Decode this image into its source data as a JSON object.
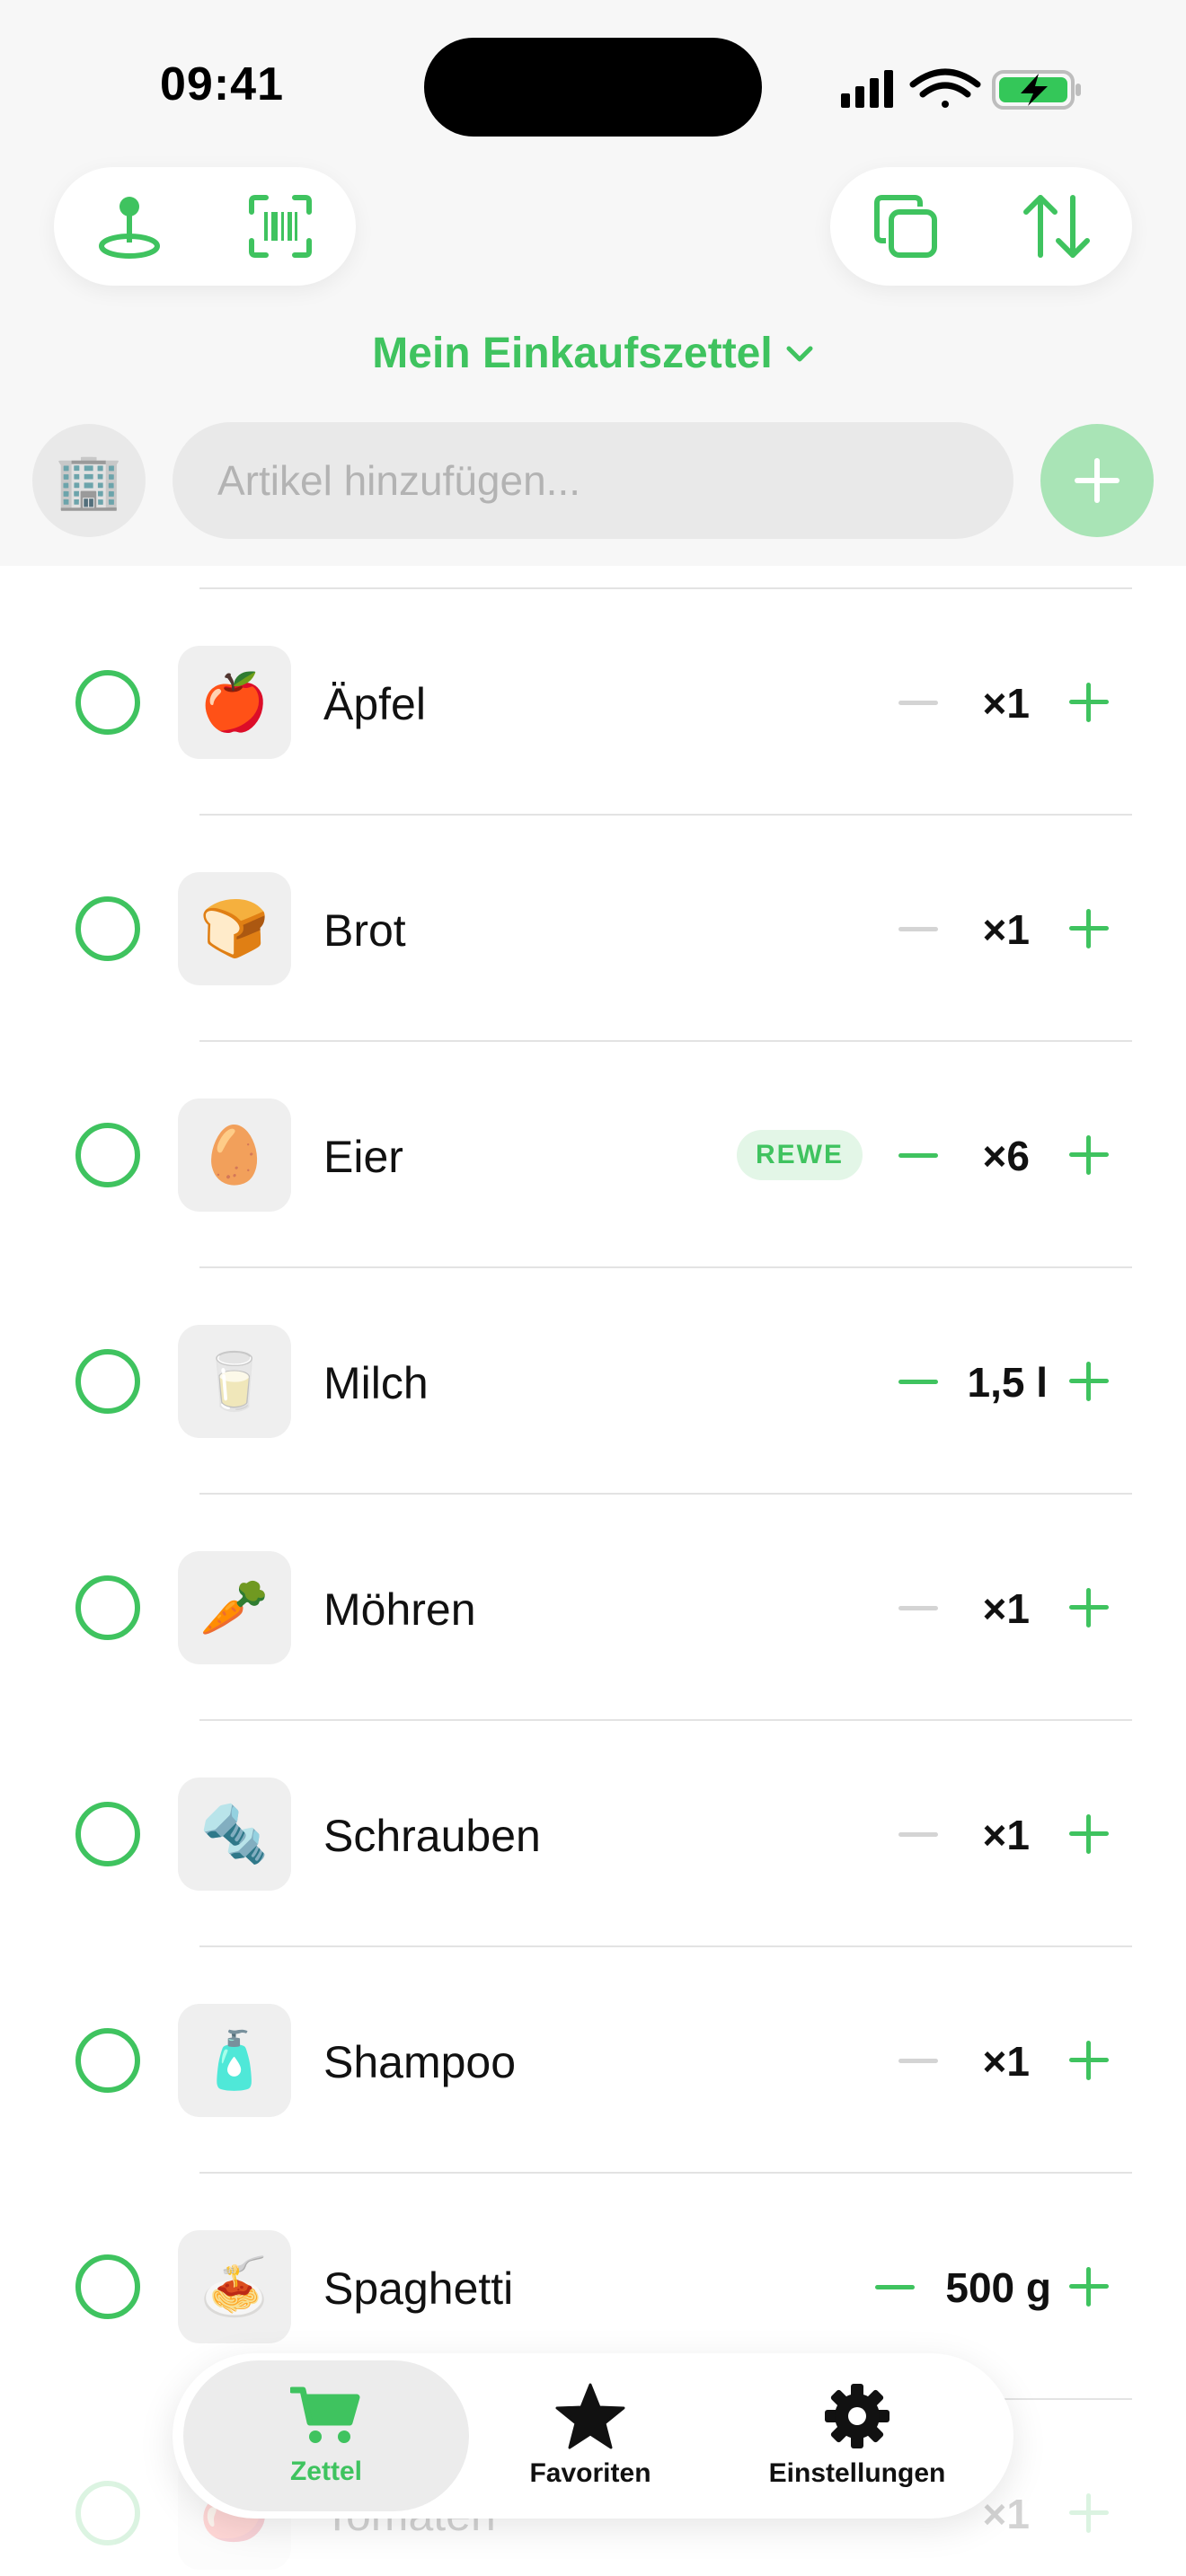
{
  "status": {
    "time": "09:41"
  },
  "header": {
    "list_title": "Mein Einkaufszettel",
    "input_placeholder": "Artikel hinzufügen..."
  },
  "icons": {
    "store": "office-building-emoji",
    "location": "map-pin-icon",
    "barcode": "barcode-scan-icon",
    "duplicate": "copy-icon",
    "sort": "sort-arrows-icon",
    "add": "plus-icon"
  },
  "colors": {
    "accent": "#3fc35f",
    "accent_light": "#a9e4b6",
    "badge_bg": "#e3f6e7"
  },
  "items": [
    {
      "name": "Äpfel",
      "emoji": "🍎",
      "qty": "×1",
      "badge": "",
      "minus_active": false
    },
    {
      "name": "Brot",
      "emoji": "🍞",
      "qty": "×1",
      "badge": "",
      "minus_active": false
    },
    {
      "name": "Eier",
      "emoji": "🥚",
      "qty": "×6",
      "badge": "REWE",
      "minus_active": true
    },
    {
      "name": "Milch",
      "emoji": "🥛",
      "qty": "1,5 l",
      "badge": "",
      "minus_active": true
    },
    {
      "name": "Möhren",
      "emoji": "🥕",
      "qty": "×1",
      "badge": "",
      "minus_active": false
    },
    {
      "name": "Schrauben",
      "emoji": "🔩",
      "qty": "×1",
      "badge": "",
      "minus_active": false
    },
    {
      "name": "Shampoo",
      "emoji": "🧴",
      "qty": "×1",
      "badge": "",
      "minus_active": false
    },
    {
      "name": "Spaghetti",
      "emoji": "🍝",
      "qty": "500 g",
      "badge": "",
      "minus_active": true
    },
    {
      "name": "Tomaten",
      "emoji": "🍅",
      "qty": "×1",
      "badge": "",
      "minus_active": false
    }
  ],
  "tabs": [
    {
      "label": "Zettel",
      "icon": "cart-icon",
      "active": true
    },
    {
      "label": "Favoriten",
      "icon": "star-icon",
      "active": false
    },
    {
      "label": "Einstellungen",
      "icon": "gear-icon",
      "active": false
    }
  ]
}
